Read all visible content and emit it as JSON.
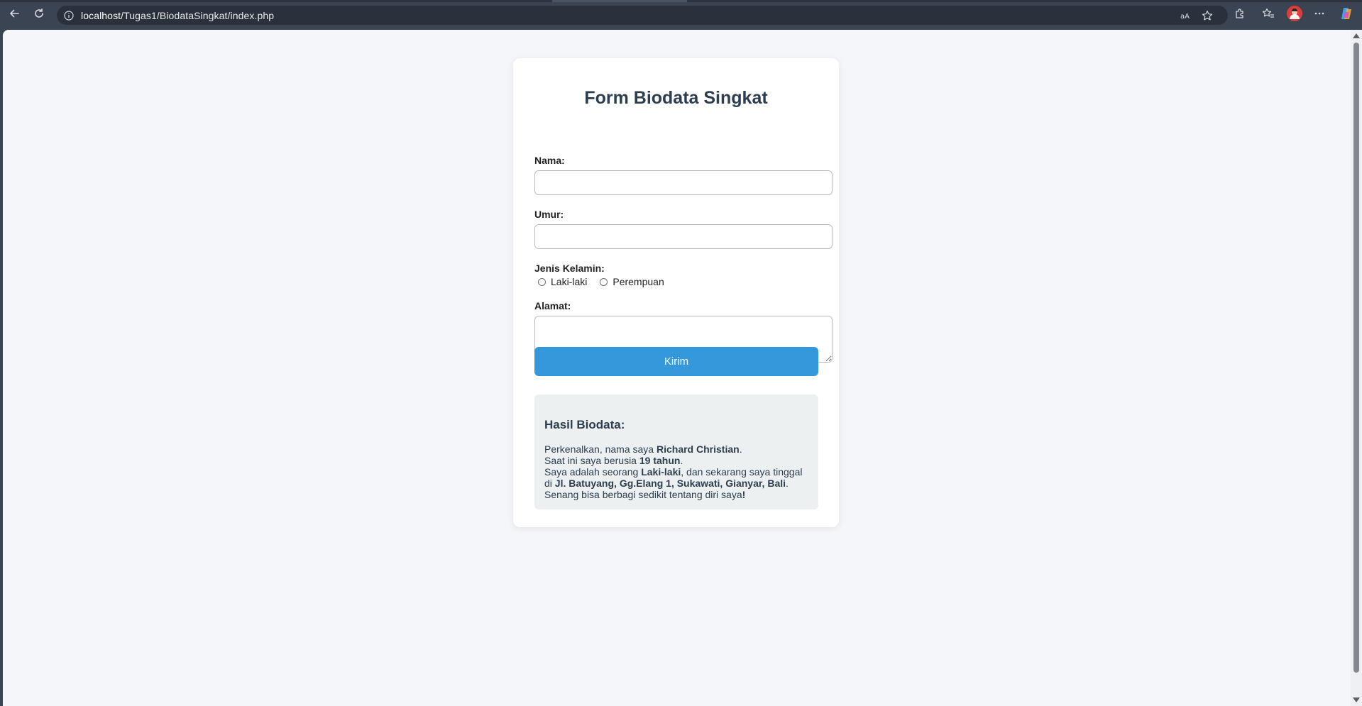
{
  "browser": {
    "url_host": "localhost",
    "url_path": "/Tugas1/BiodataSingkat/index.php"
  },
  "form": {
    "title": "Form Biodata Singkat",
    "nama_label": "Nama:",
    "nama_value": "",
    "umur_label": "Umur:",
    "umur_value": "",
    "gender_label": "Jenis Kelamin:",
    "gender_options": [
      "Laki-laki",
      "Perempuan"
    ],
    "alamat_label": "Alamat:",
    "alamat_value": "",
    "submit_label": "Kirim"
  },
  "result": {
    "title": "Hasil Biodata:",
    "intro": "Perkenalkan, nama saya ",
    "name": "Richard Christian",
    "age_prefix": "Saat ini saya berusia ",
    "age": "19 tahun",
    "gender_prefix": "Saya adalah seorang ",
    "gender": "Laki-laki",
    "address_prefix": ", dan sekarang saya tinggal di ",
    "address": "Jl. Batuyang, Gg.Elang 1, Sukawati, Gianyar, Bali",
    "closing": "Senang bisa berbagi sedikit tentang diri saya",
    "closing_mark": "!",
    "period": "."
  },
  "colors": {
    "accent": "#3498db",
    "title": "#2c3e50",
    "page_bg": "#f4f6f9",
    "result_bg": "#ecf0f1"
  }
}
